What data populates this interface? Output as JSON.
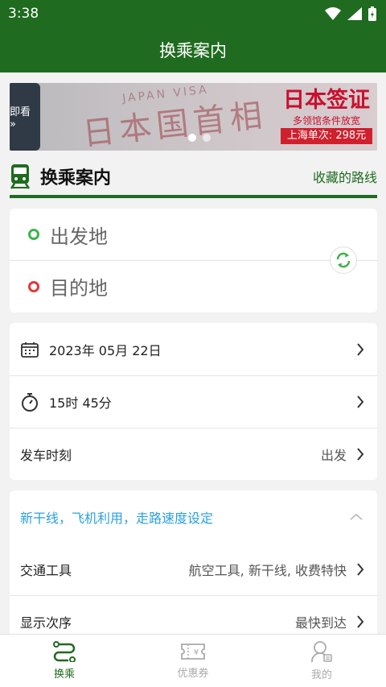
{
  "status": {
    "time": "3:38"
  },
  "appbar": {
    "title": "换乘案内"
  },
  "banner": {
    "tab_text": "即看 »",
    "stamp_text": "日本国首相",
    "visa_text": "JAPAN VISA",
    "promo_title": "日本签证",
    "promo_sub": "多领馆条件放宽",
    "promo_price": "上海单次: 298元",
    "slides": 2,
    "active_slide": 0
  },
  "section": {
    "title": "换乘案内",
    "saved_routes": "收藏的路线"
  },
  "stations": {
    "from_placeholder": "出发地",
    "to_placeholder": "目的地"
  },
  "datetime": {
    "date": "2023年 05月 22日",
    "time": "15时 45分",
    "departure_label": "发车时刻",
    "departure_value": "出发"
  },
  "options": {
    "header": "新干线，飞机利用，走路速度设定",
    "transport_label": "交通工具",
    "transport_value": "航空工具, 新干线, 收费特快",
    "order_label": "显示次序",
    "order_value": "最快到达"
  },
  "nav": [
    {
      "label": "换乘",
      "icon": "route-icon",
      "active": true
    },
    {
      "label": "优惠券",
      "icon": "coupon-icon",
      "active": false
    },
    {
      "label": "我的",
      "icon": "profile-icon",
      "active": false
    }
  ],
  "colors": {
    "brand": "#1f6b1f",
    "accent_blue": "#2aa0e0",
    "from_dot": "#3bb54a",
    "to_dot": "#e53935"
  }
}
